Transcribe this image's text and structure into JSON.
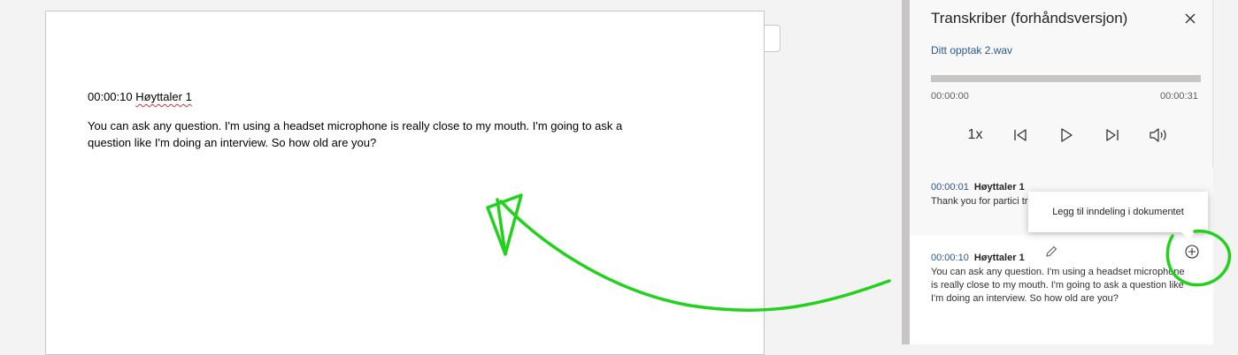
{
  "document": {
    "timestamp": "00:00:10",
    "speaker": "Høyttaler 1",
    "body": "You can ask any question. I'm using a headset microphone is really close to my mouth. I'm going to ask a question like I'm doing an interview. So how old are you?"
  },
  "pane": {
    "title": "Transkriber (forhåndsversjon)",
    "file_name": "Ditt opptak 2.wav",
    "progress": 0,
    "time_start": "00:00:00",
    "time_end": "00:00:31",
    "speed": "1x"
  },
  "entries": [
    {
      "timestamp": "00:00:01",
      "speaker": "Høyttaler 1",
      "text": "Thank you for partici trial of the transcribe"
    },
    {
      "timestamp": "00:00:10",
      "speaker": "Høyttaler 1",
      "text": "You can ask any question. I'm using a headset microphone is really close to my mouth. I'm going to ask a question like I'm doing an interview. So how old are you?"
    }
  ],
  "tooltip": {
    "text": "Legg til inndeling i dokumentet"
  },
  "icons": {
    "close": "close-icon",
    "previous": "skip-back-icon",
    "play": "play-icon",
    "next": "skip-forward-icon",
    "volume": "volume-icon",
    "edit": "pencil-icon",
    "add": "add-circle-icon"
  },
  "colors": {
    "accent": "#2b5797",
    "annotation": "#22d11b"
  }
}
